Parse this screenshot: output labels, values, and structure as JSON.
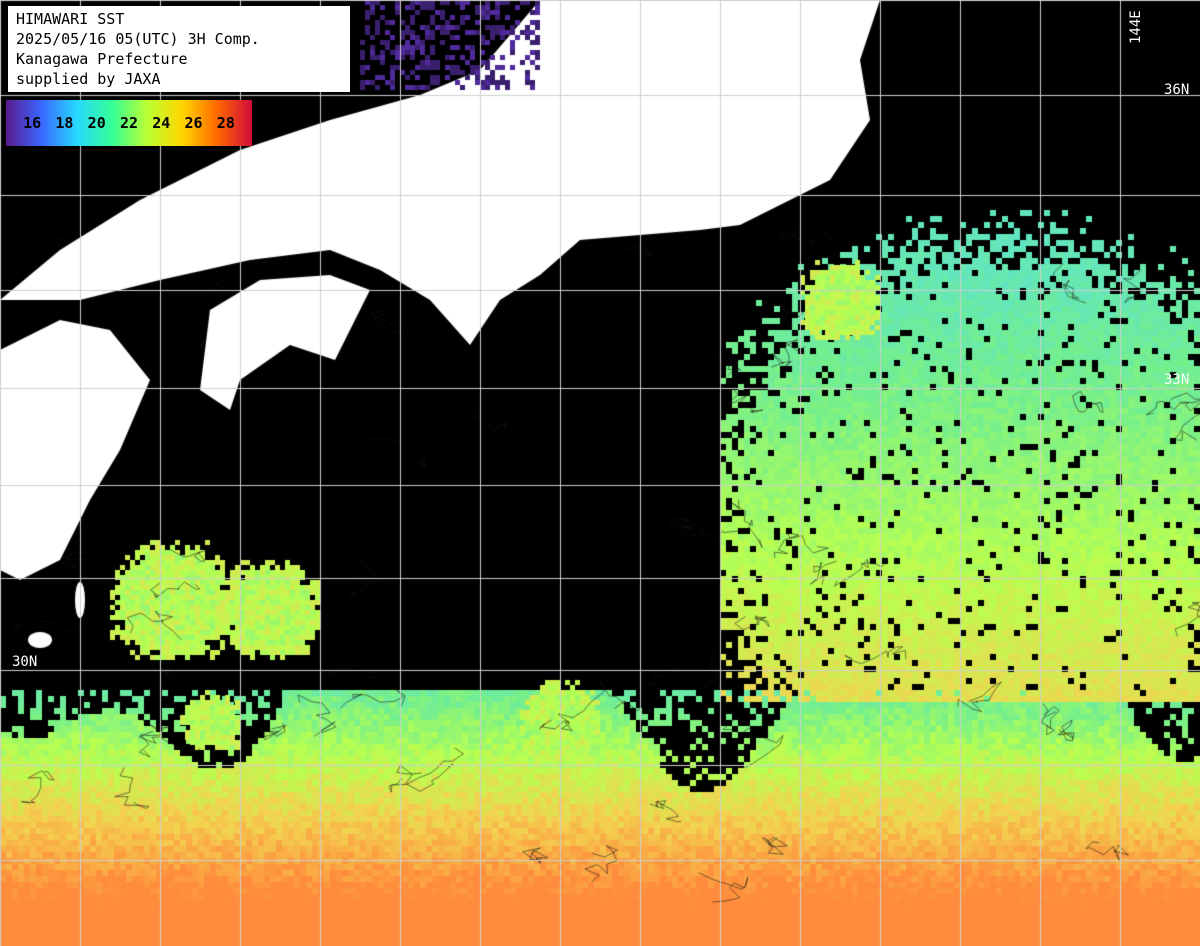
{
  "header": {
    "lines": [
      "HIMAWARI SST",
      "2025/05/16 05(UTC) 3H Comp.",
      "Kanagawa Prefecture",
      "supplied by JAXA"
    ]
  },
  "colorbar": {
    "ticks": [
      "16",
      "18",
      "20",
      "22",
      "24",
      "26",
      "28"
    ],
    "colors": [
      "#5a1a8c",
      "#3a66ff",
      "#27d7ff",
      "#33ff99",
      "#b8ff33",
      "#ffd700",
      "#ff6a00",
      "#d10a3a"
    ]
  },
  "graticule": {
    "lat_labels": [
      {
        "text": "36N",
        "value": 36
      },
      {
        "text": "33N",
        "value": 33
      },
      {
        "text": "30N",
        "value": 30
      }
    ],
    "lon_labels": [
      {
        "text": "144E",
        "value": 144
      }
    ]
  },
  "colors": {
    "background": "#000000",
    "land": "#ffffff",
    "grid": "#cfcfcf",
    "ocean_warm": "#f3b54a",
    "ocean_cool": "#49d9ff",
    "ocean_mid": "#75ef8c"
  }
}
